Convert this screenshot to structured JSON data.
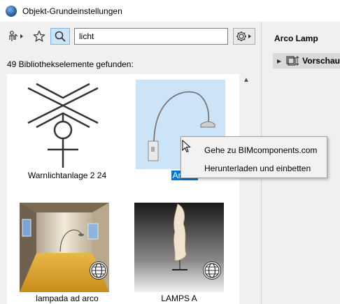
{
  "window": {
    "title": "Objekt-Grundeinstellungen"
  },
  "toolbar": {
    "search_value": "licht",
    "icons": [
      "library-icon",
      "star-icon",
      "search-icon",
      "gear-icon"
    ]
  },
  "results": {
    "count_label": "49 Bibliothekselemente gefunden:"
  },
  "items": [
    {
      "label": "Warnlichtanlage 2 24",
      "selected": false,
      "online": false
    },
    {
      "label": "Arco Lamp",
      "visible_label": "Arco L",
      "selected": true,
      "online": false
    },
    {
      "label": "lampada ad arco",
      "selected": false,
      "online": true
    },
    {
      "label": "LAMPS A",
      "selected": false,
      "online": true
    }
  ],
  "context_menu": {
    "items": [
      "Gehe zu BIMcomponents.com",
      "Herunterladen und einbetten"
    ]
  },
  "details": {
    "title": "Arco Lamp",
    "preview_label": "Vorschau"
  },
  "colors": {
    "selection": "#cce4f7",
    "selection_text_bg": "#0078d7"
  }
}
